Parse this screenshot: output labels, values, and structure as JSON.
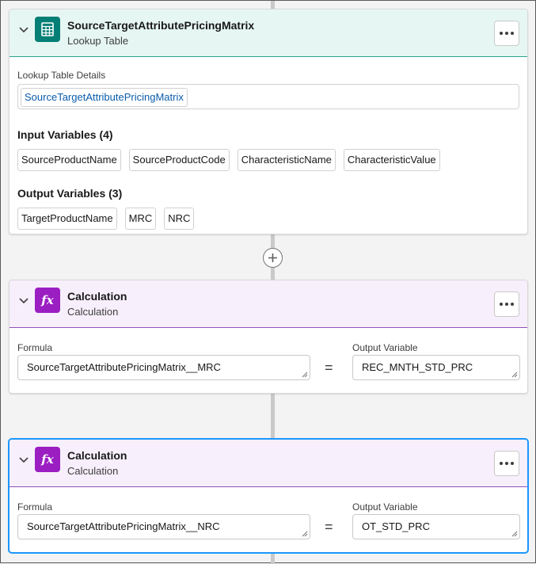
{
  "lookup": {
    "title": "SourceTargetAttributePricingMatrix",
    "subtitle": "Lookup Table",
    "details_label": "Lookup Table Details",
    "details_value": "SourceTargetAttributePricingMatrix",
    "input_title": "Input Variables (4)",
    "inputs": [
      "SourceProductName",
      "SourceProductCode",
      "CharacteristicName",
      "CharacteristicValue"
    ],
    "output_title": "Output Variables (3)",
    "outputs": [
      "TargetProductName",
      "MRC",
      "NRC"
    ]
  },
  "calc1": {
    "title": "Calculation",
    "subtitle": "Calculation",
    "formula_label": "Formula",
    "formula_value": "SourceTargetAttributePricingMatrix__MRC",
    "equals": "=",
    "output_label": "Output Variable",
    "output_value": "REC_MNTH_STD_PRC"
  },
  "calc2": {
    "title": "Calculation",
    "subtitle": "Calculation",
    "formula_label": "Formula",
    "formula_value": "SourceTargetAttributePricingMatrix__NRC",
    "equals": "=",
    "output_label": "Output Variable",
    "output_value": "OT_STD_PRC"
  },
  "icons": {
    "chevron": "chevron-down-icon",
    "lookup_tile": "table-icon",
    "calc_tile": "formula-icon",
    "menu": "more-actions-icon",
    "add": "add-icon"
  },
  "colors": {
    "lookup_tile": "#047f75",
    "calc_tile": "#9b1ec2",
    "lookup_header": "#e6f7f3",
    "calc_header": "#f7effb",
    "selected_border": "#1b96ff",
    "link": "#0b5cab"
  }
}
